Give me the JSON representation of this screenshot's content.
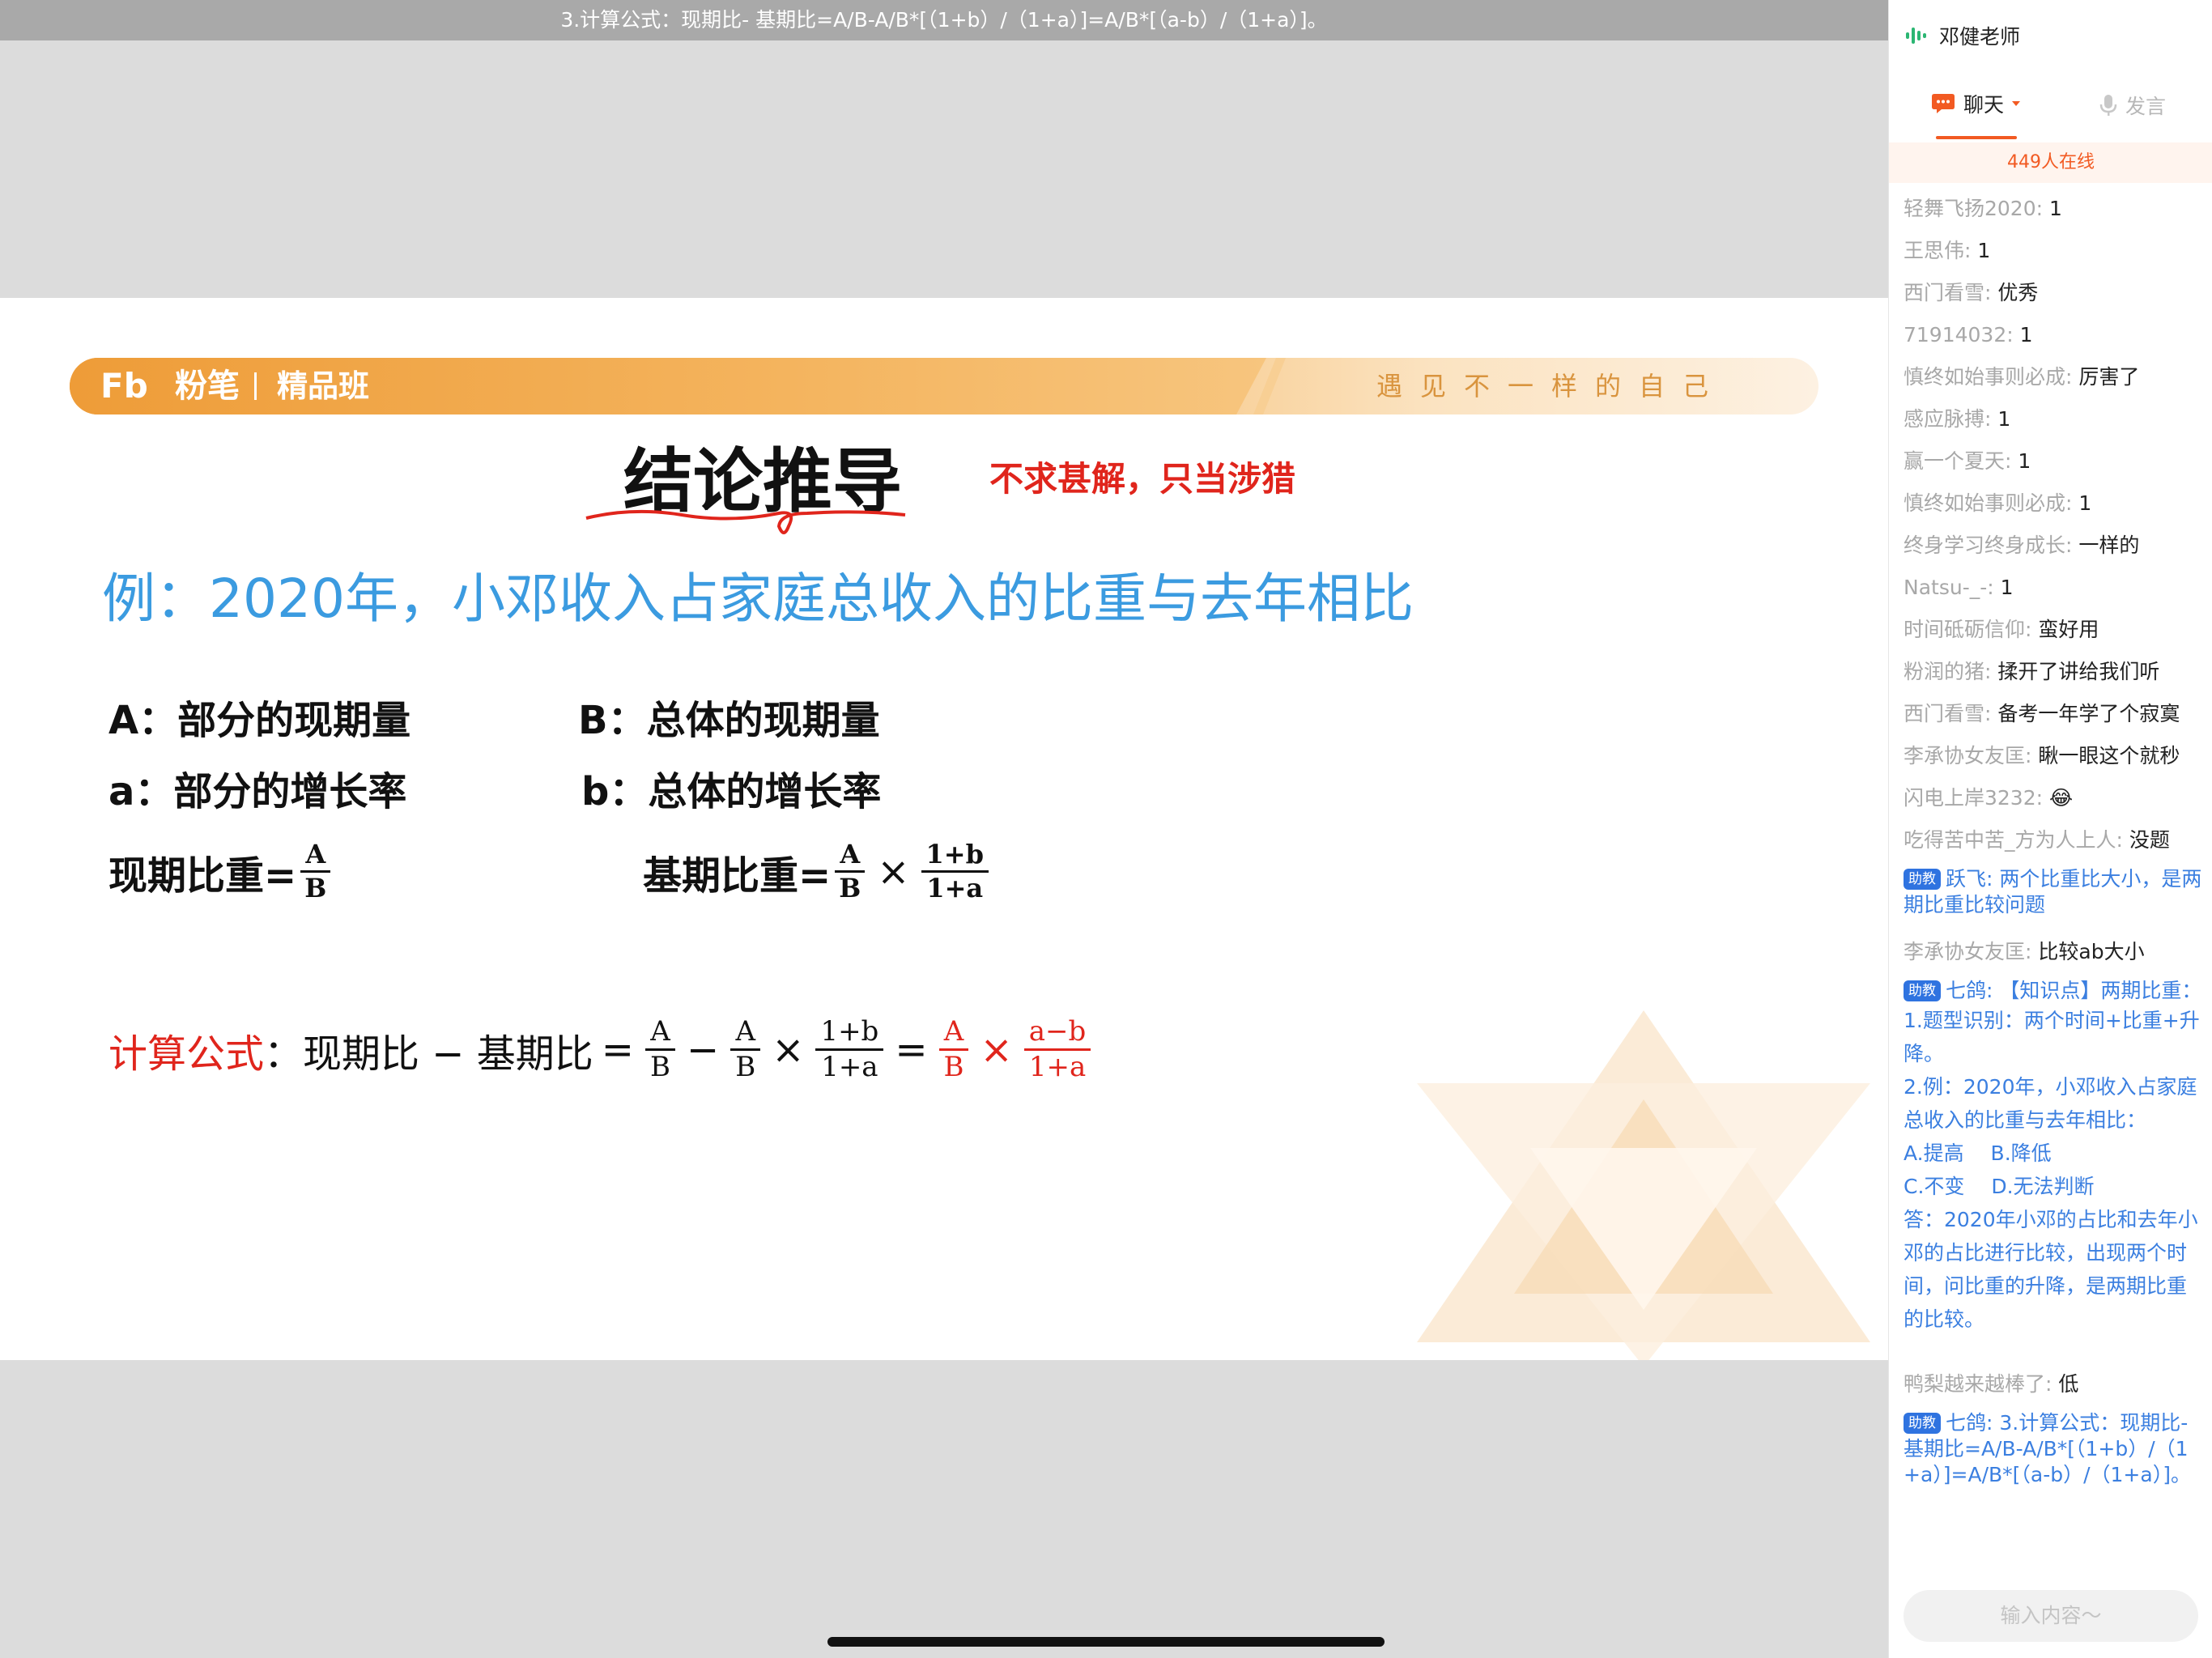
{
  "top_banner": "3.计算公式：现期比- 基期比=A/B-A/B*[（1+b）/（1+a）]=A/B*[（a-b）/（1+a）]。",
  "slide": {
    "brand": {
      "logo": "Fb",
      "name": "粉笔",
      "class_name": "精品班",
      "slogan": "遇见不一样的自己"
    },
    "title": "结论推导",
    "subtitle": "不求甚解，只当涉猎",
    "example": "例：2020年，小邓收入占家庭总收入的比重与去年相比",
    "definitions": {
      "A": "A：部分的现期量",
      "B": "B：总体的现期量",
      "a": "a：部分的增长率",
      "b": "b：总体的增长率"
    },
    "current_ratio": {
      "label": "现期比重=",
      "num": "A",
      "den": "B"
    },
    "base_ratio": {
      "label": "基期比重=",
      "num1": "A",
      "den1": "B",
      "times": "×",
      "num2": "1+b",
      "den2": "1+a"
    },
    "calc": {
      "label": "计算公式",
      "colon": "：",
      "lhs": "现期比 − 基期比",
      "eq": "=",
      "minus": "−",
      "times": "×",
      "f1_num": "A",
      "f1_den": "B",
      "f2_num": "A",
      "f2_den": "B",
      "f3_num": "1+b",
      "f3_den": "1+a",
      "f4_num": "A",
      "f4_den": "B",
      "f5_num": "a−b",
      "f5_den": "1+a"
    }
  },
  "chat": {
    "teacher": "邓健老师",
    "tab_chat": "聊天",
    "tab_speak": "发言",
    "online": "449人在线",
    "messages": [
      {
        "user": "轻舞飞扬2020: ",
        "text": "1"
      },
      {
        "user": "王思伟: ",
        "text": "1"
      },
      {
        "user": "西门看雪: ",
        "text": "优秀"
      },
      {
        "user": "71914032: ",
        "text": "1"
      },
      {
        "user": "慎终如始事则必成: ",
        "text": "厉害了"
      },
      {
        "user": "感应脉搏: ",
        "text": "1"
      },
      {
        "user": "赢一个夏天: ",
        "text": "1"
      },
      {
        "user": "慎终如始事则必成: ",
        "text": "1"
      },
      {
        "user": "终身学习终身成长: ",
        "text": "一样的"
      },
      {
        "user": "Natsu-_-: ",
        "text": "1"
      },
      {
        "user": "时间砥砺信仰: ",
        "text": "蛮好用"
      },
      {
        "user": "粉润的猪: ",
        "text": "揉开了讲给我们听"
      },
      {
        "user": "西门看雪: ",
        "text": "备考一年学了个寂寞"
      },
      {
        "user": "李承协女友匡: ",
        "text": "瞅一眼这个就秒"
      },
      {
        "user": "闪电上岸3232: ",
        "text": "😂"
      },
      {
        "user": "吃得苦中苦_方为人上人: ",
        "text": "没题"
      }
    ],
    "assistant_1": {
      "badge": "助教",
      "user": "跃飞: ",
      "text": "两个比重比大小，是两期比重比较问题"
    },
    "message_17": {
      "user": "李承协女友匡: ",
      "text": "比较ab大小"
    },
    "assistant_2": {
      "badge": "助教",
      "user": "七鸽: ",
      "text": "【知识点】两期比重：",
      "lines": [
        "1.题型识别：两个时间+比重+升降。",
        "2.例：2020年，小邓收入占家庭总收入的比重与去年相比：",
        "A.提高　 B.降低",
        "C.不变　 D.无法判断",
        "答：2020年小邓的占比和去年小邓的占比进行比较，出现两个时间，问比重的升降，是两期比重的比较。"
      ]
    },
    "message_18": {
      "user": "鸭梨越来越棒了: ",
      "text": "低"
    },
    "assistant_3": {
      "badge": "助教",
      "user": "七鸽: ",
      "text": "3.计算公式：现期比- 基期比=A/B-A/B*[（1+b）/（1+a）]=A/B*[（a-b）/（1+a）]。"
    },
    "input_placeholder": "输入内容～"
  }
}
